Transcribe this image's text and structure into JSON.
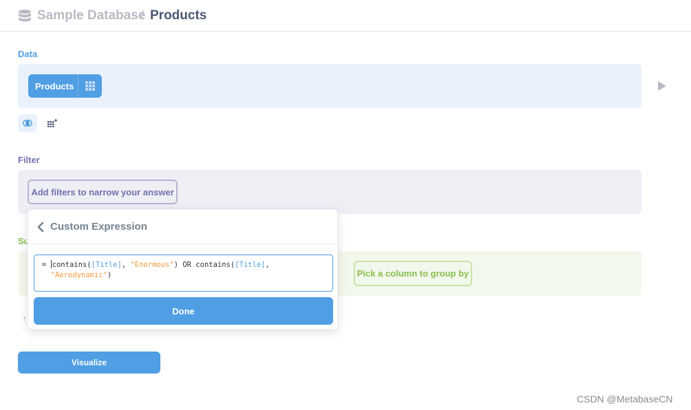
{
  "breadcrumb": {
    "database_icon": "database-icon",
    "database": "Sample Database",
    "separator": "/",
    "table": "Products"
  },
  "sections": {
    "data_label": "Data",
    "filter_label": "Filter",
    "summarize_label": "Su"
  },
  "data_step": {
    "table_pill": "Products",
    "pill_icon": "grid-icon",
    "run_icon": "play-icon",
    "actions": [
      {
        "icon": "join-icon"
      },
      {
        "icon": "custom-column-icon"
      }
    ]
  },
  "filter_step": {
    "add_filter_label": "Add filters to narrow your answer"
  },
  "summarize_step": {
    "group_by_label": "Pick a column to group by",
    "sort_icon": "↑"
  },
  "popover": {
    "back_icon": "chevron-left-icon",
    "title": "Custom Expression",
    "expression": {
      "eq": "=",
      "fn1": "contains(",
      "field1": "[Title]",
      "sep1": ", ",
      "str1": "\"Enormous\"",
      "mid": ") OR contains(",
      "field2": "[Title]",
      "sep2": ",",
      "str2": "\"Aerodynamic\"",
      "close": ")"
    },
    "done_label": "Done"
  },
  "visualize_label": "Visualize",
  "watermark": "CSDN @MetabaseCN",
  "colors": {
    "brand": "#509ee3",
    "filter": "#7172ad",
    "summarize": "#88bf4d",
    "string_token": "#f39a3e"
  }
}
